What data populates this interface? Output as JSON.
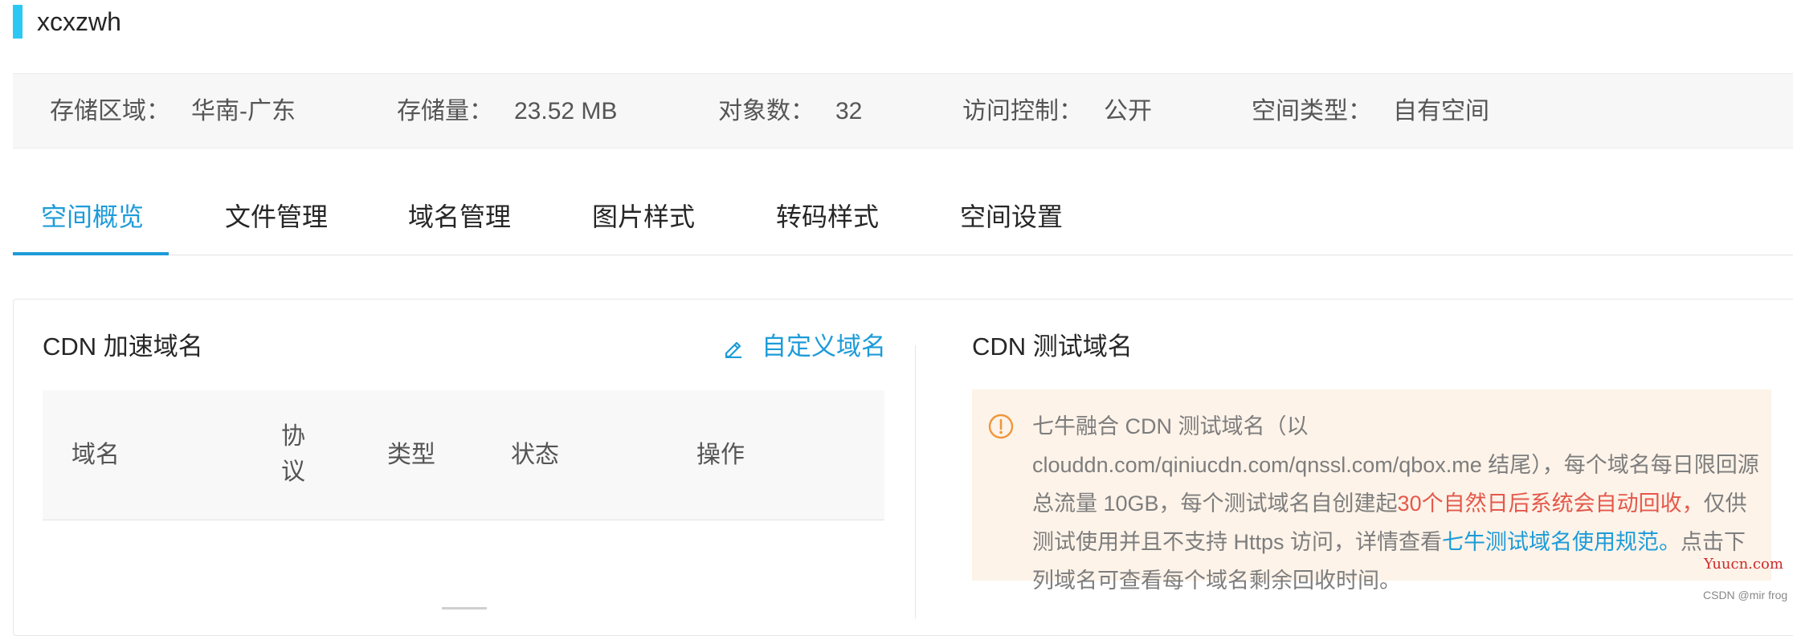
{
  "header": {
    "bucket_name": "xcxzwh",
    "accent_color": "#2bc8f4"
  },
  "info_bar": {
    "region_label": "存储区域：",
    "region_value": "华南-广东",
    "storage_label": "存储量：",
    "storage_value": "23.52 MB",
    "objects_label": "对象数：",
    "objects_value": "32",
    "access_label": "访问控制：",
    "access_value": "公开",
    "type_label": "空间类型：",
    "type_value": "自有空间"
  },
  "tabs": [
    {
      "label": "空间概览",
      "active": true
    },
    {
      "label": "文件管理",
      "active": false
    },
    {
      "label": "域名管理",
      "active": false
    },
    {
      "label": "图片样式",
      "active": false
    },
    {
      "label": "转码样式",
      "active": false
    },
    {
      "label": "空间设置",
      "active": false
    }
  ],
  "cdn_accel": {
    "title": "CDN 加速域名",
    "custom_domain_label": "自定义域名",
    "columns": {
      "domain": "域名",
      "protocol": "协议",
      "type": "类型",
      "status": "状态",
      "actions": "操作"
    }
  },
  "cdn_test": {
    "title": "CDN 测试域名",
    "notice_part1": "七牛融合 CDN 测试域名（以 clouddn.com/qiniucdn.com/qnssl.com/qbox.me 结尾），每个域名每日限回源总流量 10GB，每个测试域名自创建起",
    "notice_warning": "30个自然日后系统会自动回收，",
    "notice_part2": "仅供测试使用并且不支持 Https 访问，详情查看",
    "notice_link": "七牛测试域名使用规范。",
    "notice_part3": "点击下列域名可查看每个域名剩余回收时间。"
  },
  "watermarks": {
    "site": "Yuucn.com",
    "author": "CSDN @mir frog"
  },
  "colors": {
    "primary": "#1d9bd8",
    "warning_text": "#e4584b",
    "notice_bg": "#fdf3e9",
    "notice_icon": "#f0963a"
  },
  "icons": {
    "edit": "pencil-icon",
    "notice": "exclamation-circle-icon"
  }
}
